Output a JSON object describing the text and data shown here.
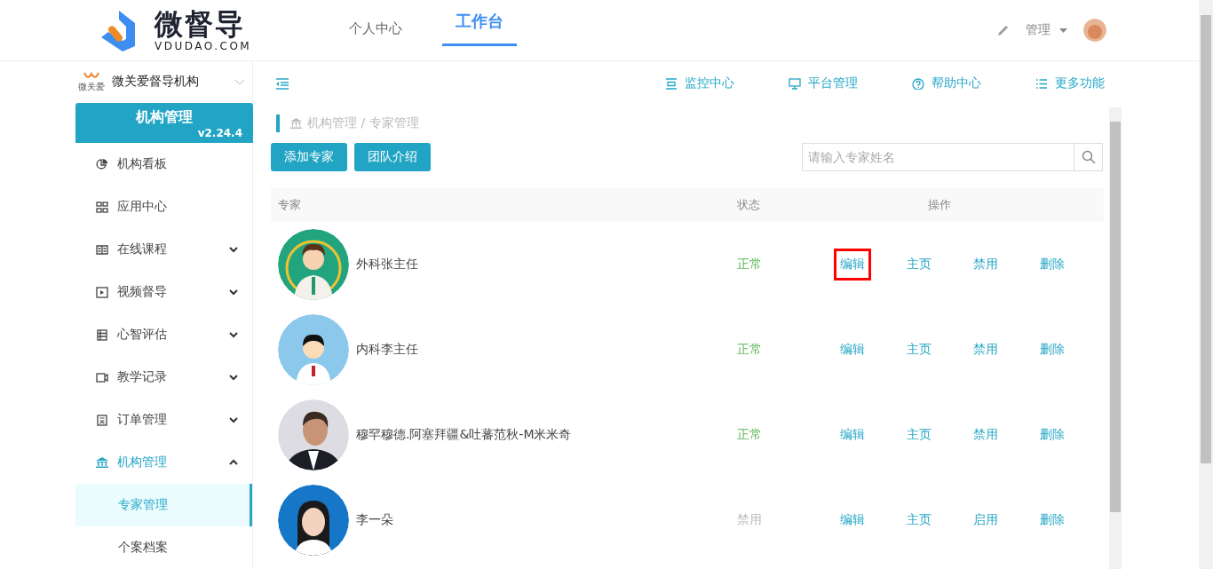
{
  "header": {
    "logo_title": "微督导",
    "logo_subtitle": "VDUDAO.COM",
    "nav": [
      {
        "label": "个人中心",
        "selected": false
      },
      {
        "label": "工作台",
        "selected": true
      }
    ],
    "user_menu": "管理"
  },
  "sidebar": {
    "org_name": "微关爱督导机构",
    "org_logo_text": "微关爱",
    "card_title": "机构管理",
    "card_version": "v2.24.4",
    "items": [
      {
        "label": "机构看板",
        "selected": false
      },
      {
        "label": "应用中心",
        "selected": false
      },
      {
        "label": "在线课程",
        "expanded": false,
        "selected": false
      },
      {
        "label": "视频督导",
        "expanded": false,
        "selected": false
      },
      {
        "label": "心智评估",
        "expanded": false,
        "selected": false
      },
      {
        "label": "教学记录",
        "expanded": false,
        "selected": false
      },
      {
        "label": "订单管理",
        "expanded": false,
        "selected": false
      },
      {
        "label": "机构管理",
        "expanded": true,
        "selected": true,
        "children": [
          {
            "label": "专家管理",
            "selected": true
          },
          {
            "label": "个案档案",
            "selected": false
          }
        ]
      }
    ]
  },
  "toolbar": [
    {
      "label": "监控中心"
    },
    {
      "label": "平台管理"
    },
    {
      "label": "帮助中心"
    },
    {
      "label": "更多功能"
    }
  ],
  "breadcrumb": "机构管理 / 专家管理",
  "buttons": [
    "添加专家",
    "团队介绍"
  ],
  "search": {
    "placeholder": "请输入专家姓名"
  },
  "table": {
    "columns": [
      "专家",
      "状态",
      "操作"
    ],
    "rows": [
      {
        "name": "外科张主任",
        "status": "正常",
        "active": true,
        "actions": [
          {
            "label": "编辑",
            "highlighted": true
          },
          {
            "label": "主页",
            "highlighted": false
          },
          {
            "label": "禁用",
            "highlighted": false
          },
          {
            "label": "删除",
            "highlighted": false
          }
        ]
      },
      {
        "name": "内科李主任",
        "status": "正常",
        "active": true,
        "actions": [
          {
            "label": "编辑",
            "highlighted": false
          },
          {
            "label": "主页",
            "highlighted": false
          },
          {
            "label": "禁用",
            "highlighted": false
          },
          {
            "label": "删除",
            "highlighted": false
          }
        ]
      },
      {
        "name": "穆罕穆德.阿塞拜疆&吐蕃范秋-M米米奇",
        "status": "正常",
        "active": true,
        "actions": [
          {
            "label": "编辑",
            "highlighted": false
          },
          {
            "label": "主页",
            "highlighted": false
          },
          {
            "label": "禁用",
            "highlighted": false
          },
          {
            "label": "删除",
            "highlighted": false
          }
        ]
      },
      {
        "name": "李一朵",
        "status": "禁用",
        "active": false,
        "actions": [
          {
            "label": "编辑",
            "highlighted": false
          },
          {
            "label": "主页",
            "highlighted": false
          },
          {
            "label": "启用",
            "highlighted": false
          },
          {
            "label": "删除",
            "highlighted": false
          }
        ]
      }
    ]
  }
}
